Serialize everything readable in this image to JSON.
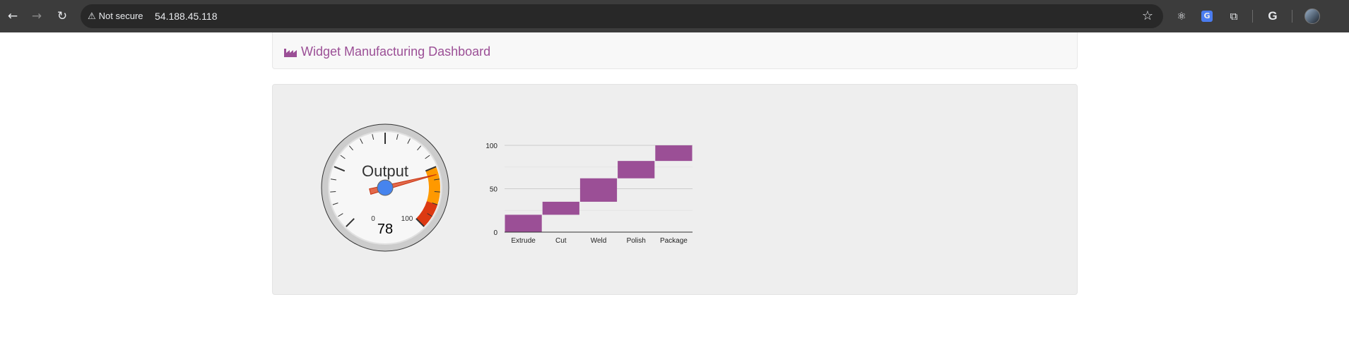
{
  "browser": {
    "security_label": "Not secure",
    "url": "54.188.45.118",
    "back_icon": "back-arrow-icon",
    "forward_icon": "forward-arrow-icon",
    "reload_icon": "reload-icon",
    "extensions": [
      "react-devtools-icon",
      "translate-icon",
      "puzzle-extensions-icon",
      "google-icon",
      "profile-avatar"
    ]
  },
  "navbar": {
    "brand_icon": "factory-icon",
    "brand_text": "Widget Manufacturing Dashboard",
    "brand_color": "#9b4f96"
  },
  "gauge": {
    "label": "Output",
    "value": 78,
    "min": 0,
    "max": 100,
    "min_label": "0",
    "max_label": "100",
    "value_label": "78",
    "yellow_range": [
      75,
      90
    ],
    "red_range": [
      90,
      100
    ],
    "needle_color": "#dc3912",
    "hub_color": "#4684ee"
  },
  "chart_data": {
    "type": "bar",
    "subtype": "waterfall",
    "categories": [
      "Extrude",
      "Cut",
      "Weld",
      "Polish",
      "Package"
    ],
    "ranges": [
      [
        0,
        20
      ],
      [
        20,
        35
      ],
      [
        35,
        62
      ],
      [
        62,
        82
      ],
      [
        82,
        100
      ]
    ],
    "ylim": [
      0,
      100
    ],
    "y_ticks": [
      0,
      50,
      100
    ],
    "y_tick_labels": [
      "0",
      "50",
      "100"
    ],
    "minor_gridlines": [
      25,
      75
    ],
    "bar_color": "#9b4f96",
    "grid": true,
    "title": "",
    "xlabel": "",
    "ylabel": ""
  }
}
